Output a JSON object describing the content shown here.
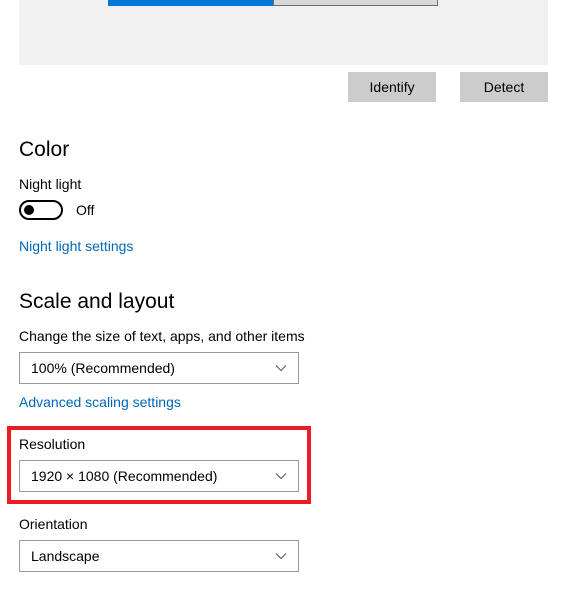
{
  "preview": {
    "identify_label": "Identify",
    "detect_label": "Detect"
  },
  "color": {
    "heading": "Color",
    "night_light_label": "Night light",
    "night_light_state": "Off",
    "night_light_settings_link": "Night light settings"
  },
  "scale": {
    "heading": "Scale and layout",
    "scale_label": "Change the size of text, apps, and other items",
    "scale_value": "100% (Recommended)",
    "advanced_link": "Advanced scaling settings",
    "resolution_label": "Resolution",
    "resolution_value": "1920 × 1080 (Recommended)",
    "orientation_label": "Orientation",
    "orientation_value": "Landscape"
  }
}
